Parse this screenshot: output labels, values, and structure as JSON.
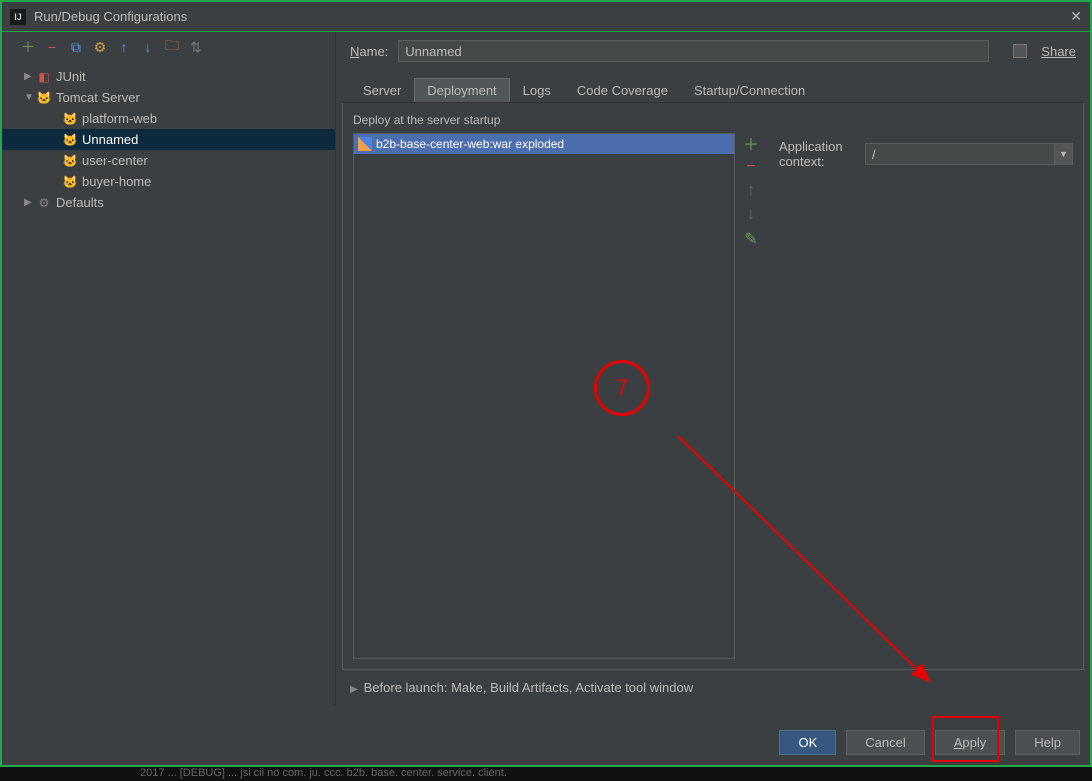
{
  "window": {
    "title": "Run/Debug Configurations",
    "icon_glyph": "IJ"
  },
  "toolbar_icons": [
    "add",
    "remove",
    "copy",
    "wrench",
    "up",
    "down",
    "folder",
    "sort"
  ],
  "tree": {
    "junit": {
      "label": "JUnit"
    },
    "tomcat": {
      "label": "Tomcat Server"
    },
    "items": [
      {
        "label": "platform-web"
      },
      {
        "label": "Unnamed"
      },
      {
        "label": "user-center"
      },
      {
        "label": "buyer-home"
      }
    ],
    "defaults": {
      "label": "Defaults"
    }
  },
  "name_field": {
    "label": "Name:",
    "value": "Unnamed"
  },
  "share": {
    "label": "Share"
  },
  "tabs": [
    "Server",
    "Deployment",
    "Logs",
    "Code Coverage",
    "Startup/Connection"
  ],
  "deploy": {
    "label": "Deploy at the server startup",
    "items": [
      "b2b-base-center-web:war exploded"
    ],
    "context_label": "Application context:",
    "context_value": "/"
  },
  "before_launch": {
    "label": "Before launch: Make, Build Artifacts, Activate tool window"
  },
  "buttons": {
    "ok": "OK",
    "cancel": "Cancel",
    "apply": "Apply",
    "help": "Help"
  },
  "annotation": {
    "number": "7"
  },
  "status_line": "2017 ...  [DEBUG] ... jsi cii no com. ju. ccc. b2b. base. center. service. client."
}
